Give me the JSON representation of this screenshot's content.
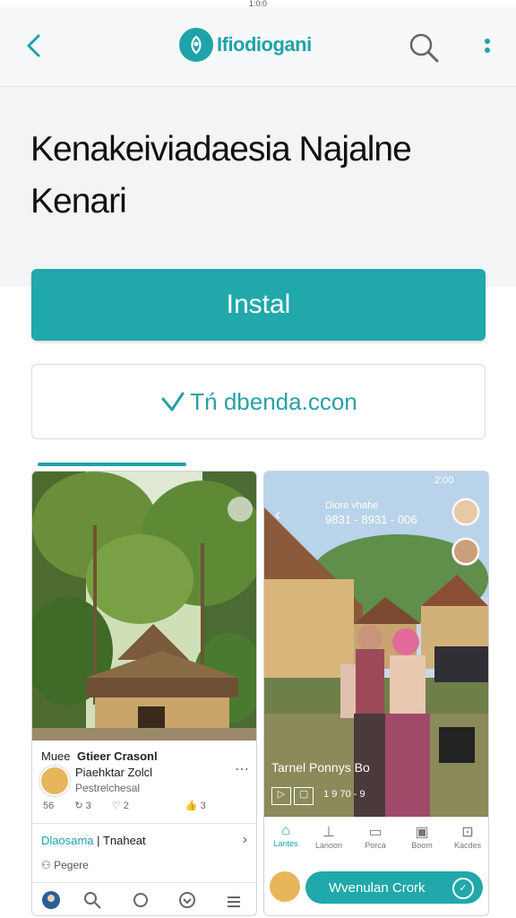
{
  "status": {
    "text": "1:0:0"
  },
  "appbar": {
    "brand": "Ifiodiogani",
    "back_icon": "back-arrow-icon",
    "search_icon": "search-icon",
    "more_icon": "more-vertical-icon",
    "accent": "#1fa3a8"
  },
  "hero": {
    "title": "Kenakeiviadaesia Najalne Kenari"
  },
  "actions": {
    "install_label": "Instal",
    "wishlist_label": "Tń dbenda.ccon",
    "wishlist_icon": "heart-check-icon"
  },
  "screenshots": {
    "shot1": {
      "caption_left": "Muee",
      "caption_title": "Gtieer Crasonl",
      "subtitle": "Piaehktar Zolcl",
      "meta": "Pestrelchesal",
      "stats": [
        "56",
        "3",
        "2",
        "3"
      ],
      "link_label": "Dlaosama",
      "link_separator": "|",
      "link_suffix": "Tnaheat",
      "footer_text": "Pegere",
      "nav_icons": [
        "profile-icon",
        "search-icon",
        "circle-icon",
        "heart-icon",
        "menu-icon"
      ]
    },
    "shot2": {
      "top_time": "2:00",
      "overlay_line1": "Diore vhahe",
      "overlay_line2": "9831 - 8931 - 006",
      "overlay_caption": "Tarnel Ponnys Bo",
      "overlay_meta": "1 9 70 - 9",
      "tabs": [
        "Lantes",
        "Lanoon",
        "Porca",
        "Boom",
        "Kacdes"
      ],
      "pill_label": "Wvenulan Crork"
    }
  }
}
